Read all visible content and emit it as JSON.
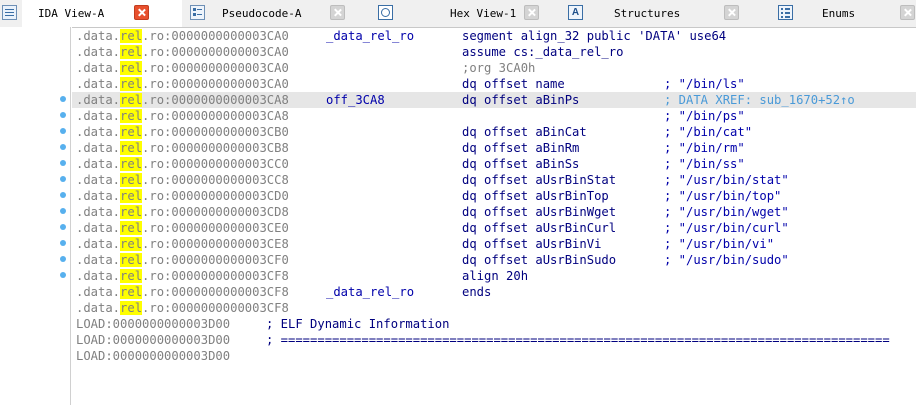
{
  "tabs": [
    {
      "label": "IDA View-A",
      "active": true,
      "icon": "listing-icon"
    },
    {
      "label": "Pseudocode-A",
      "active": false,
      "icon": "pseudocode-icon"
    },
    {
      "label": "Hex View-1",
      "active": false,
      "icon": "hex-icon"
    },
    {
      "label": "Structures",
      "active": false,
      "icon": "structures-icon"
    },
    {
      "label": "Enums",
      "active": false,
      "icon": "enums-icon"
    }
  ],
  "colors": {
    "segment_highlight": "#ffff00",
    "active_close": "#e8502d",
    "breakpoint_dot": "#57b0ee",
    "selected_row": "#e6e6e6"
  },
  "listing": {
    "seg_prefix": ".data.",
    "seg_hl": "rel",
    "seg_suffix": ".ro:",
    "rows": [
      {
        "addr": "0000000000003CA0",
        "label": "_data_rel_ro",
        "code": "segment align_32 public 'DATA' use64",
        "comment": "",
        "dot": false
      },
      {
        "addr": "0000000000003CA0",
        "label": "",
        "code": "assume cs:_data_rel_ro",
        "comment": "",
        "dot": false
      },
      {
        "addr": "0000000000003CA0",
        "label": "",
        "code": ";org 3CA0h",
        "comment": "",
        "dot": false
      },
      {
        "addr": "0000000000003CA0",
        "label": "",
        "code": "dq offset name",
        "comment": "; \"/bin/ls\"",
        "dot": false
      },
      {
        "addr": "0000000000003CA8",
        "label": "off_3CA8",
        "code": "dq offset aBinPs",
        "comment": "; DATA XREF: sub_1670+52↑o",
        "dot": true,
        "selected": true
      },
      {
        "addr": "0000000000003CA8",
        "label": "",
        "code": "",
        "comment": "; \"/bin/ps\"",
        "dot": true
      },
      {
        "addr": "0000000000003CB0",
        "label": "",
        "code": "dq offset aBinCat",
        "comment": "; \"/bin/cat\"",
        "dot": true
      },
      {
        "addr": "0000000000003CB8",
        "label": "",
        "code": "dq offset aBinRm",
        "comment": "; \"/bin/rm\"",
        "dot": true
      },
      {
        "addr": "0000000000003CC0",
        "label": "",
        "code": "dq offset aBinSs",
        "comment": "; \"/bin/ss\"",
        "dot": true
      },
      {
        "addr": "0000000000003CC8",
        "label": "",
        "code": "dq offset aUsrBinStat",
        "comment": "; \"/usr/bin/stat\"",
        "dot": true
      },
      {
        "addr": "0000000000003CD0",
        "label": "",
        "code": "dq offset aUsrBinTop",
        "comment": "; \"/usr/bin/top\"",
        "dot": true
      },
      {
        "addr": "0000000000003CD8",
        "label": "",
        "code": "dq offset aUsrBinWget",
        "comment": "; \"/usr/bin/wget\"",
        "dot": true
      },
      {
        "addr": "0000000000003CE0",
        "label": "",
        "code": "dq offset aUsrBinCurl",
        "comment": "; \"/usr/bin/curl\"",
        "dot": true
      },
      {
        "addr": "0000000000003CE8",
        "label": "",
        "code": "dq offset aUsrBinVi",
        "comment": "; \"/usr/bin/vi\"",
        "dot": true
      },
      {
        "addr": "0000000000003CF0",
        "label": "",
        "code": "dq offset aUsrBinSudo",
        "comment": "; \"/usr/bin/sudo\"",
        "dot": true
      },
      {
        "addr": "0000000000003CF8",
        "label": "",
        "code": "align 20h",
        "comment": "",
        "dot": true
      },
      {
        "addr": "0000000000003CF8",
        "label": "_data_rel_ro",
        "code": "ends",
        "comment": "",
        "dot": false
      },
      {
        "addr": "0000000000003CF8",
        "label": "",
        "code": "",
        "comment": "",
        "dot": false
      }
    ],
    "load_rows": [
      {
        "prefix": "LOAD:0000000000003D00",
        "text": "; ELF Dynamic Information"
      },
      {
        "prefix": "LOAD:0000000000003D00",
        "text": "; ==================================================================================="
      },
      {
        "prefix": "LOAD:0000000000003D00",
        "text": ""
      }
    ]
  }
}
